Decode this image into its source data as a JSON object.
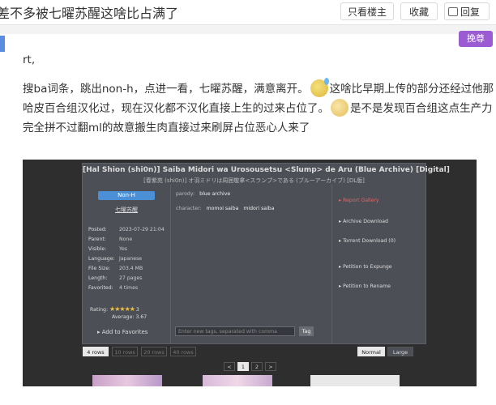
{
  "topbar": {
    "title": "差不多被七曜苏醒这啥比占满了",
    "only_author": "只看楼主",
    "favorite": "收藏",
    "reply": "回复"
  },
  "badge": {
    "manjun": "挽尊"
  },
  "post": {
    "line1": "rt,",
    "para_a": "搜ba词条，跳出non-h，点进一看，七曜苏醒，满意离开。",
    "para_b": "这啥比早期上传的部分还经过他那哈皮百合组汉化过，现在汉化都不汉化直接上生的过来占位了。",
    "para_c": "是不是发现百合组这点生产力完全拼不过翻ml的故意搬生肉直接过来刷屏占位恶心人来了",
    "emoji1": "sweat-emoji-icon",
    "emoji2": "yawn-emoji-icon"
  },
  "gallery": {
    "title": "[Hal Shion (shi0n)] Saiba Midori wa Urosousetsu <Slump> de Aru (Blue Archive) [Digital]",
    "subtitle": "[春紫苑 (shi0n)] オ羽ミドリは周囲敬拿<スランプ>である (ブルーアーカイブ) [DL版]",
    "category": "Non-H",
    "uploader": "七曜苏醒",
    "meta": [
      {
        "k": "Posted:",
        "v": "2023-07-29 21:04"
      },
      {
        "k": "Parent:",
        "v": "None"
      },
      {
        "k": "Visible:",
        "v": "Yes"
      },
      {
        "k": "Language:",
        "v": "Japanese"
      },
      {
        "k": "File Size:",
        "v": "203.4 MB"
      },
      {
        "k": "Length:",
        "v": "27 pages"
      },
      {
        "k": "Favorited:",
        "v": "4 times"
      }
    ],
    "rating_label": "Rating:",
    "rating_count": "3",
    "rating_value": 4.5,
    "average": "Average: 3.67",
    "add_favorites": "Add to Favorites",
    "tags": {
      "parody_key": "parody:",
      "parody_val": "blue archive",
      "character_key": "character:",
      "character_val1": "momoi saiba",
      "character_val2": "midori saiba"
    },
    "tag_placeholder": "Enter new tags, separated with comma",
    "tag_button": "Tag",
    "actions": {
      "report": "Report Gallery",
      "archive": "Archive Download",
      "torrent": "Torrent Download (0)",
      "expunge": "Petition to Expunge",
      "rename": "Petition to Rename"
    },
    "rows": [
      "4 rows",
      "10 rows",
      "20 rows",
      "40 rows"
    ],
    "sizes": {
      "normal": "Normal",
      "large": "Large"
    },
    "pages": [
      "<",
      "1",
      "2",
      ">"
    ]
  }
}
